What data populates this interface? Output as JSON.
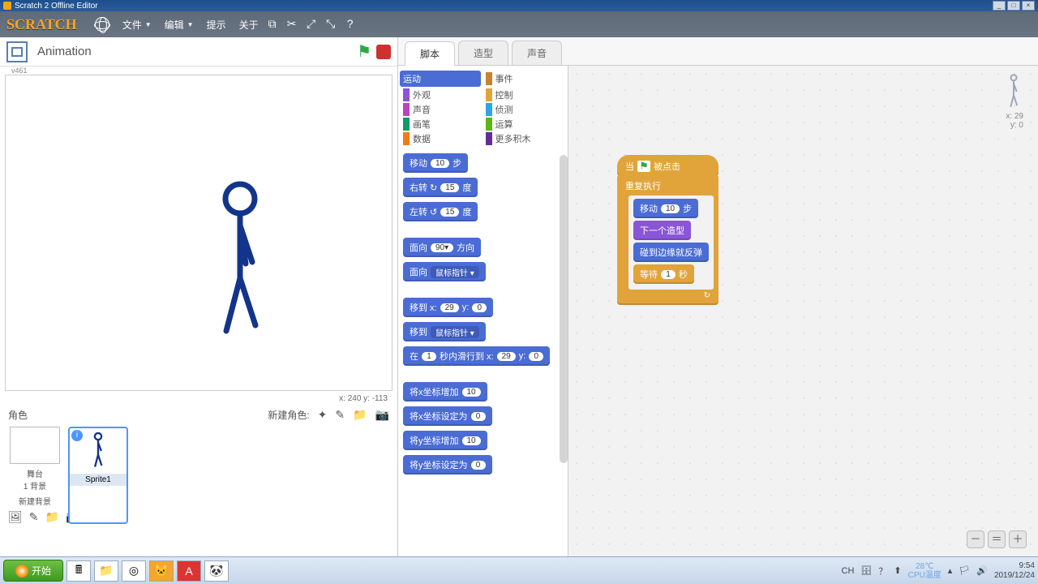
{
  "window": {
    "title": "Scratch 2 Offline Editor",
    "min": "_",
    "max": "□",
    "close": "×"
  },
  "menu": {
    "file": "文件",
    "edit": "编辑",
    "tips": "提示",
    "about": "关于",
    "logo": "SCRATCH"
  },
  "stage": {
    "title": "Animation",
    "version": "v461",
    "coords": "x: 240  y: -113"
  },
  "sprites": {
    "label": "角色",
    "newLabel": "新建角色:",
    "stageLabel": "舞台",
    "stageCount": "1 背景",
    "newBgLabel": "新建背景",
    "sprite1": "Sprite1"
  },
  "tabs": {
    "scripts": "脚本",
    "costumes": "造型",
    "sounds": "声音"
  },
  "categories": {
    "motion": "运动",
    "looks": "外观",
    "sound": "声音",
    "pen": "画笔",
    "data": "数据",
    "events": "事件",
    "control": "控制",
    "sensing": "侦测",
    "operators": "运算",
    "more": "更多积木"
  },
  "catColors": {
    "motion": "#4a6cd4",
    "looks": "#8a55d7",
    "sound": "#bb42c3",
    "pen": "#0e9a6c",
    "data": "#ee7d16",
    "events": "#c88330",
    "control": "#e1a43b",
    "sensing": "#2ca5e2",
    "operators": "#5cb712",
    "more": "#632d99"
  },
  "blocks": {
    "move": {
      "pre": "移动",
      "n": "10",
      "post": "步"
    },
    "turnR": {
      "pre": "右转 ↻",
      "n": "15",
      "post": "度"
    },
    "turnL": {
      "pre": "左转 ↺",
      "n": "15",
      "post": "度"
    },
    "point": {
      "pre": "面向",
      "n": "90▾",
      "post": "方向"
    },
    "pointTo": {
      "pre": "面向",
      "dd": "鼠标指针 ▾"
    },
    "goto": {
      "pre": "移到 x:",
      "x": "29",
      "mid": "y:",
      "y": "0"
    },
    "gotoObj": {
      "pre": "移到",
      "dd": "鼠标指针 ▾"
    },
    "glide": {
      "pre": "在",
      "s": "1",
      "mid": "秒内滑行到 x:",
      "x": "29",
      "mid2": "y:",
      "y": "0"
    },
    "dx": {
      "pre": "将x坐标增加",
      "n": "10"
    },
    "sx": {
      "pre": "将x坐标设定为",
      "n": "0"
    },
    "dy": {
      "pre": "将y坐标增加",
      "n": "10"
    },
    "sy": {
      "pre": "将y坐标设定为",
      "n": "0"
    }
  },
  "script": {
    "hat": "当            被点击",
    "forever": "重复执行",
    "move": {
      "pre": "移动",
      "n": "10",
      "post": "步"
    },
    "next": "下一个造型",
    "bounce": "碰到边缘就反弹",
    "wait": {
      "pre": "等待",
      "n": "1",
      "post": "秒"
    }
  },
  "preview": {
    "x": "x: 29",
    "y": "y: 0"
  },
  "taskbar": {
    "start": "开始",
    "ch": "CH",
    "temp": "28℃",
    "tempLabel": "CPU温度",
    "time": "9:54",
    "date": "2019/12/24"
  }
}
